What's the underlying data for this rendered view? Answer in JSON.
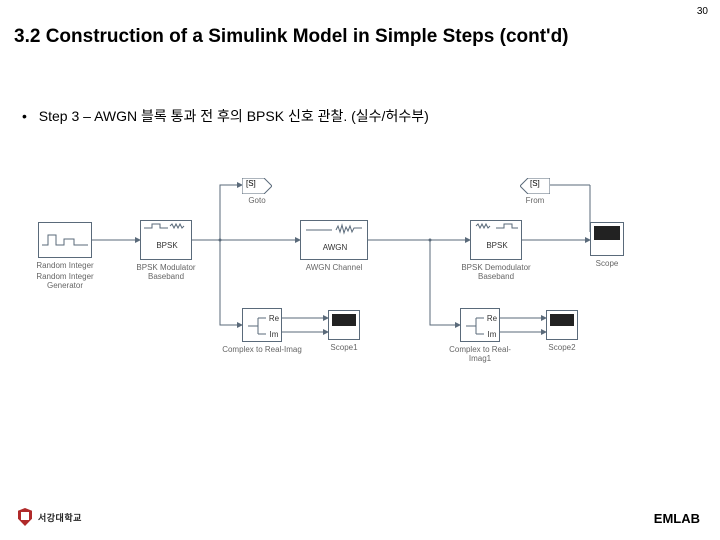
{
  "page_number": "30",
  "title": "3.2 Construction of a Simulink Model in Simple Steps (cont'd)",
  "step": {
    "bullet": "•",
    "text": "Step 3 – AWGN 블록 통과 전 후의 BPSK 신호 관찰. (실수/허수부)"
  },
  "blocks": {
    "random_int": {
      "label": "Random Integer",
      "caption": "Random Integer Generator"
    },
    "bpsk_mod": {
      "label_top": "",
      "label_mid": "BPSK",
      "caption": "BPSK Modulator Baseband"
    },
    "awgn": {
      "label": "AWGN",
      "caption": "AWGN Channel"
    },
    "bpsk_demod": {
      "label_mid": "BPSK",
      "caption": "BPSK Demodulator Baseband"
    },
    "scope": {
      "caption": "Scope"
    },
    "c2ri_1": {
      "caption": "Complex to Real-Imag",
      "re": "Re",
      "im": "Im"
    },
    "scope1": {
      "caption": "Scope1"
    },
    "c2ri_2": {
      "caption": "Complex to Real-Imag1",
      "re": "Re",
      "im": "Im"
    },
    "scope2": {
      "caption": "Scope2"
    },
    "goto": {
      "caption": "Goto",
      "tag": "[S]"
    },
    "from": {
      "caption": "From",
      "tag": "[S]"
    }
  },
  "footer": {
    "university": "서강대학교",
    "lab": "EMLAB"
  }
}
